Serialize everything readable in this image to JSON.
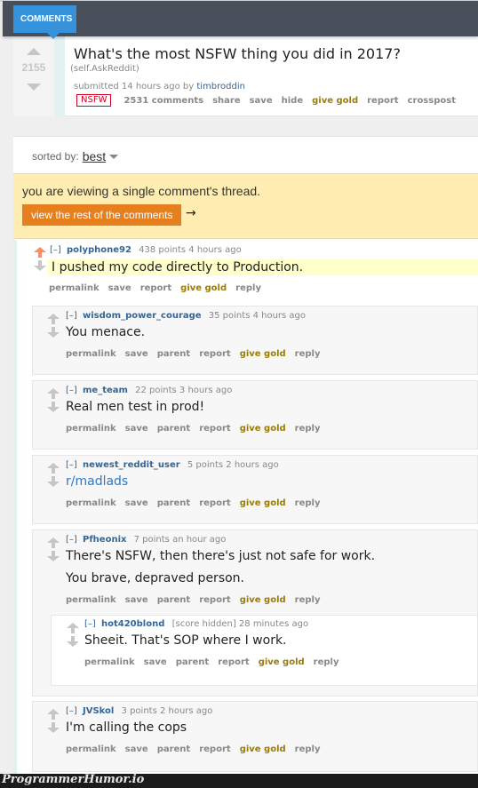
{
  "topbar": {
    "tab_label": "COMMENTS"
  },
  "post": {
    "score": "2155",
    "title": "What's the most NSFW thing you did in 2017?",
    "domain": "(self.AskReddit)",
    "submitted_prefix": "submitted 14 hours ago by",
    "author": "timbroddin",
    "nsfw_label": "NSFW",
    "buttons": [
      "2531 comments",
      "share",
      "save",
      "hide",
      "give gold",
      "report",
      "crosspost"
    ]
  },
  "sort": {
    "label": "sorted by:",
    "value": "best"
  },
  "notice": {
    "text": "you are viewing a single comment's thread.",
    "button_label": "view the rest of the comments",
    "arrow": "→"
  },
  "colors": {
    "accent_blue": "#3592db",
    "orange_button": "#e6801e",
    "upvote": "#ff8b60",
    "gold": "#9a7d0a",
    "nsfw": "#d10023",
    "notice_bg": "#ffedb2"
  },
  "comments": [
    {
      "expand": "[–]",
      "author": "polyphone92",
      "meta": "438 points 4 hours ago",
      "body": [
        "I pushed my code directly to Production."
      ],
      "actions": [
        "permalink",
        "save",
        "report",
        "give gold",
        "reply"
      ],
      "upvoted": true
    },
    {
      "expand": "[–]",
      "author": "wisdom_power_courage",
      "meta": "35 points 4 hours ago",
      "body": [
        "You menace."
      ],
      "actions": [
        "permalink",
        "save",
        "parent",
        "report",
        "give gold",
        "reply"
      ]
    },
    {
      "expand": "[–]",
      "author": "me_team",
      "meta": "22 points 3 hours ago",
      "body": [
        "Real men test in prod!"
      ],
      "actions": [
        "permalink",
        "save",
        "parent",
        "report",
        "give gold",
        "reply"
      ]
    },
    {
      "expand": "[–]",
      "author": "newest_reddit_user",
      "meta": "5 points 2 hours ago",
      "body": [
        "r/madlads"
      ],
      "actions": [
        "permalink",
        "save",
        "parent",
        "report",
        "give gold",
        "reply"
      ]
    },
    {
      "expand": "[–]",
      "author": "Pfheonix",
      "meta": "7 points an hour ago",
      "body": [
        "There's NSFW, then there's just not safe for work.",
        "You brave, depraved person."
      ],
      "actions": [
        "permalink",
        "save",
        "parent",
        "report",
        "give gold",
        "reply"
      ]
    },
    {
      "expand": "[–]",
      "author": "hot420blond",
      "meta": "[score hidden] 28 minutes ago",
      "body": [
        "Sheeit. That's SOP where I work."
      ],
      "actions": [
        "permalink",
        "save",
        "parent",
        "report",
        "give gold",
        "reply"
      ]
    },
    {
      "expand": "[–]",
      "author": "JVSkol",
      "meta": "3 points 2 hours ago",
      "body": [
        "I'm calling the cops"
      ],
      "actions": [
        "permalink",
        "save",
        "parent",
        "report",
        "give gold",
        "reply"
      ]
    }
  ],
  "footer": {
    "brand": "ProgrammerHumor.io"
  }
}
